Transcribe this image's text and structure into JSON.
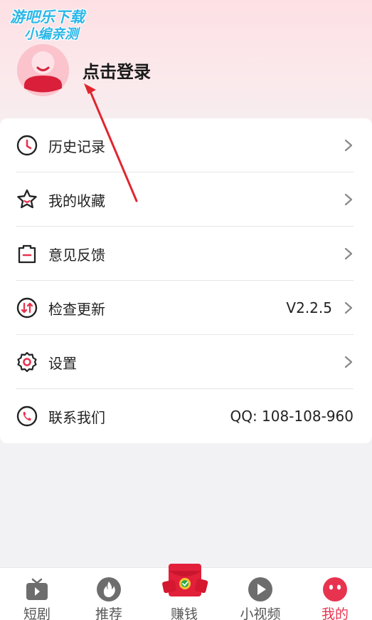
{
  "watermark": {
    "line1": "游吧乐下载",
    "line2": "小编亲测"
  },
  "header": {
    "login_label": "点击登录"
  },
  "menu": {
    "items": [
      {
        "label": "历史记录",
        "icon": "clock-icon",
        "value": ""
      },
      {
        "label": "我的收藏",
        "icon": "star-icon",
        "value": ""
      },
      {
        "label": "意见反馈",
        "icon": "feedback-icon",
        "value": ""
      },
      {
        "label": "检查更新",
        "icon": "update-icon",
        "value": "V2.2.5"
      },
      {
        "label": "设置",
        "icon": "gear-icon",
        "value": ""
      },
      {
        "label": "联系我们",
        "icon": "phone-icon",
        "value": "QQ: 108-108-960"
      }
    ]
  },
  "tabbar": {
    "tabs": [
      {
        "label": "短剧",
        "icon": "tv-icon"
      },
      {
        "label": "推荐",
        "icon": "flame-icon"
      },
      {
        "label": "赚钱",
        "icon": "red-envelope-icon"
      },
      {
        "label": "小视频",
        "icon": "play-icon"
      },
      {
        "label": "我的",
        "icon": "profile-face-icon",
        "active": true
      }
    ]
  },
  "colors": {
    "accent": "#e8334f",
    "icon_dark": "#222222",
    "icon_gray": "#6d6d6d"
  }
}
